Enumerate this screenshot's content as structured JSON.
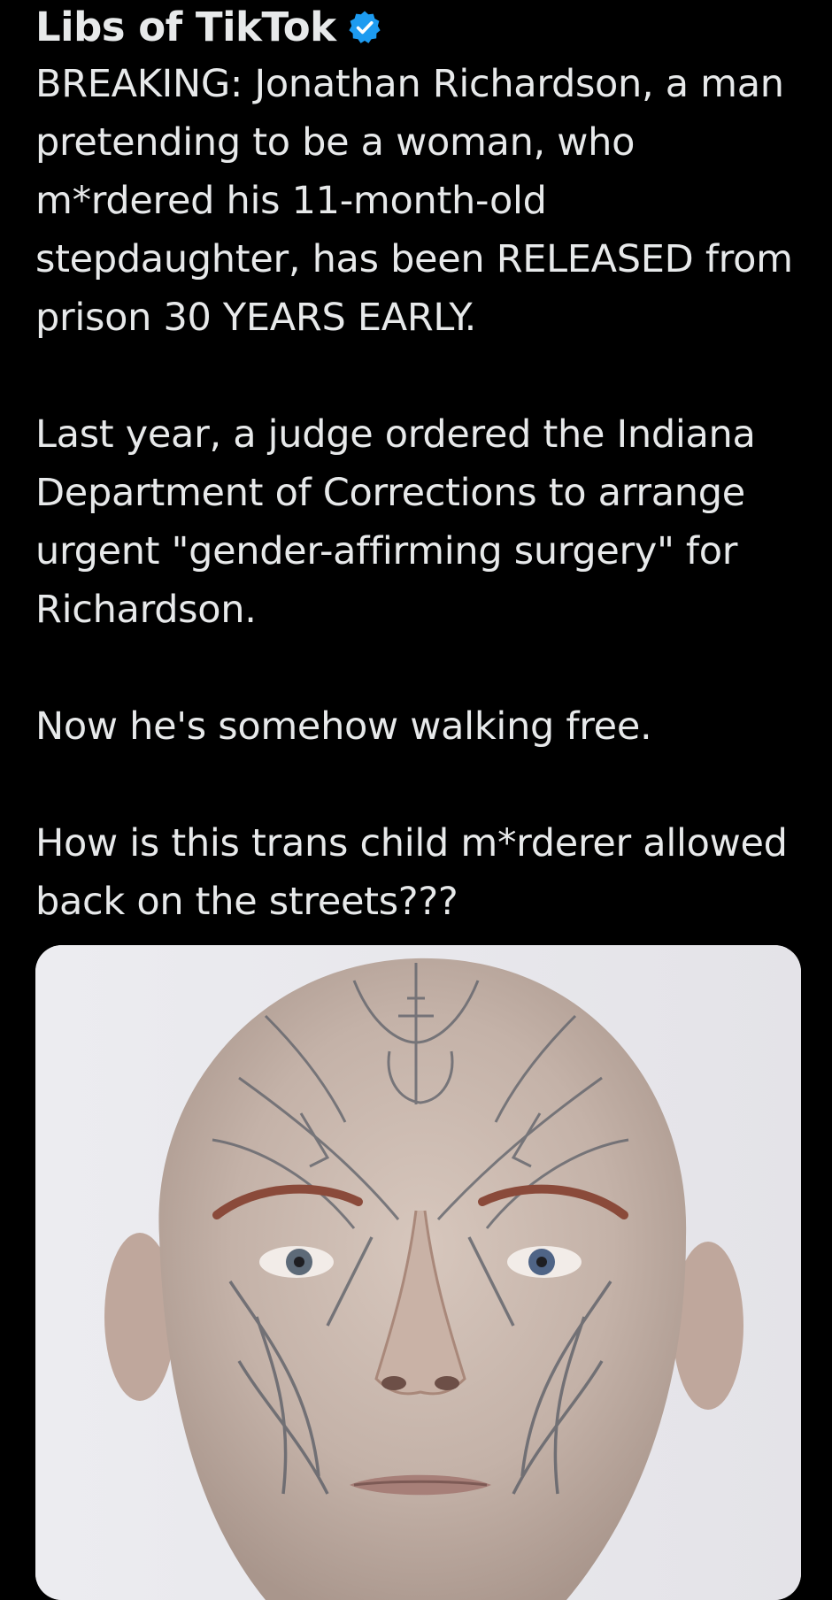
{
  "post": {
    "author": {
      "display_name": "Libs of TikTok",
      "verified_icon": "verified-badge-icon",
      "verified_color": "#1d9bf0"
    },
    "text": {
      "p1": "BREAKING: Jonathan Richardson, a man pretending to be a woman, who m*rdered his 11-month-old stepdaughter, has been RELEASED from prison 30 YEARS EARLY.",
      "p2": "Last year, a judge ordered the Indiana Department of Corrections to arrange urgent \"gender-affirming surgery\" for Richardson.",
      "p3": "Now he's somehow walking free.",
      "p4": "How is this trans child m*rderer allowed back on the streets???"
    },
    "media": {
      "type": "photo"
    }
  },
  "colors": {
    "background": "#000000",
    "text": "#e7e9ea",
    "photo_background": "#e9e8ec"
  }
}
